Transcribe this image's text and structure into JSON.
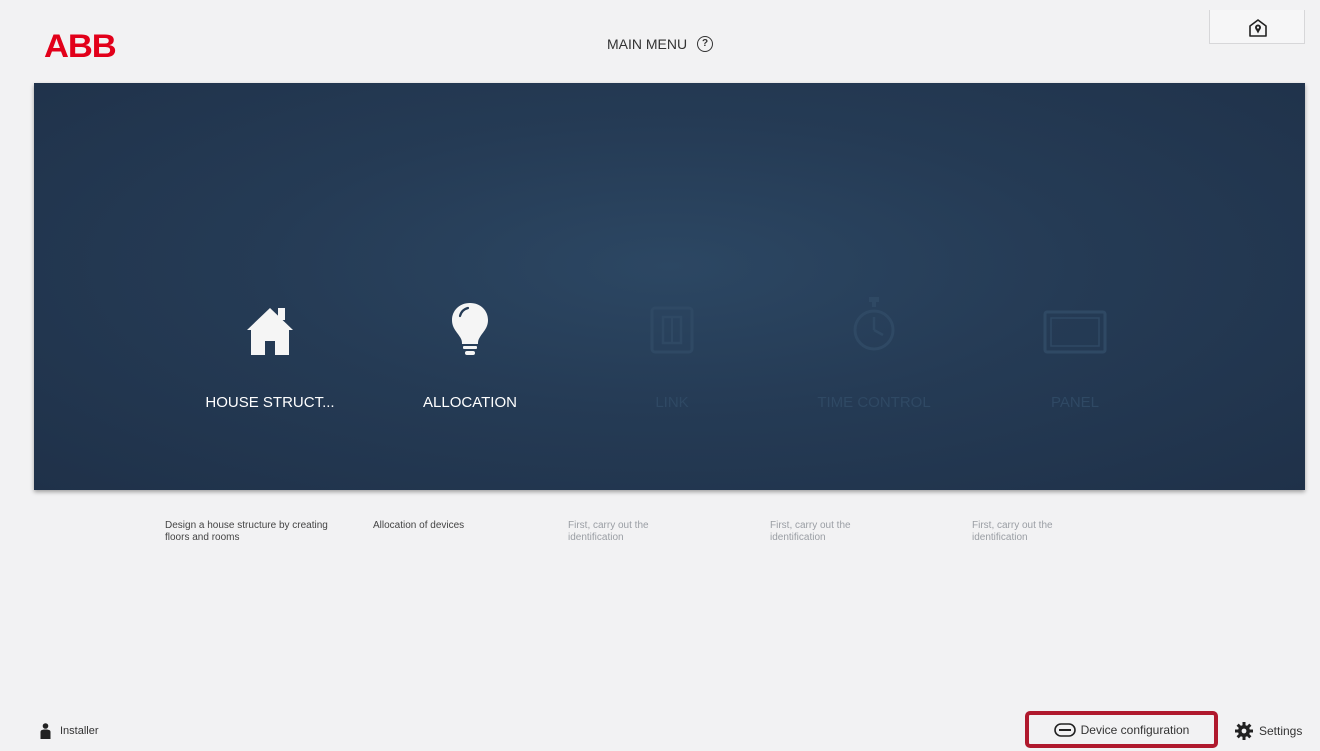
{
  "header": {
    "logo_text": "ABB",
    "title": "MAIN MENU",
    "help_glyph": "?",
    "home_icon": "house-location-icon"
  },
  "colors": {
    "brand_red": "#e2001a",
    "panel_bg": "#253b55",
    "highlight_border": "#b0192d"
  },
  "tiles": [
    {
      "label": "HOUSE STRUCT...",
      "icon": "house-icon",
      "enabled": true,
      "description": "Design a house structure by creating floors and rooms"
    },
    {
      "label": "ALLOCATION",
      "icon": "lightbulb-icon",
      "enabled": true,
      "description": "Allocation of devices"
    },
    {
      "label": "LINK",
      "icon": "link-panel-icon",
      "enabled": false,
      "description": "First, carry out the identification"
    },
    {
      "label": "TIME CONTROL",
      "icon": "stopwatch-icon",
      "enabled": false,
      "description": "First, carry out the identification"
    },
    {
      "label": "PANEL",
      "icon": "panel-icon",
      "enabled": false,
      "description": "First, carry out the identification"
    }
  ],
  "footer": {
    "user_label": "Installer",
    "device_config_label": "Device configuration",
    "settings_label": "Settings"
  }
}
